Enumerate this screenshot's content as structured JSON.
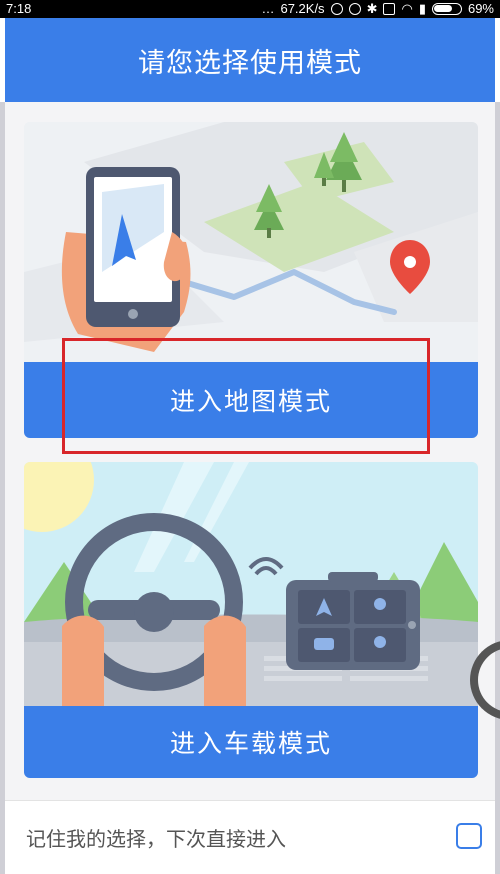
{
  "statusbar": {
    "time": "7:18",
    "network_speed": "67.2K/s",
    "battery": "69%"
  },
  "header": {
    "title": "请您选择使用模式"
  },
  "cards": {
    "map": {
      "button_label": "进入地图模式"
    },
    "car": {
      "button_label": "进入车载模式"
    }
  },
  "remember": {
    "label": "记住我的选择，下次直接进入"
  },
  "colors": {
    "primary": "#3a7ee8",
    "highlight": "#d8262a",
    "background": "#f4f4f6"
  }
}
